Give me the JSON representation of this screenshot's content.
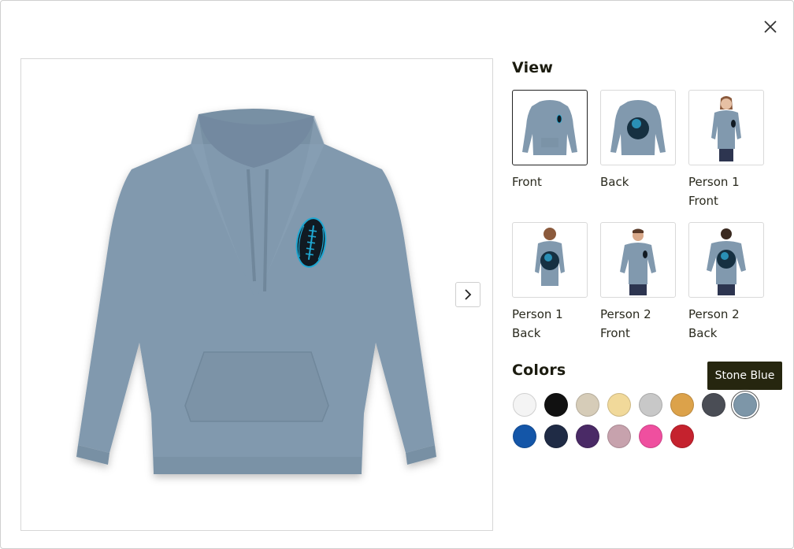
{
  "view": {
    "title": "View",
    "thumbnails": [
      {
        "label": "Front",
        "selected": true
      },
      {
        "label": "Back",
        "selected": false
      },
      {
        "label": "Person 1 Front",
        "selected": false
      },
      {
        "label": "Person 1 Back",
        "selected": false
      },
      {
        "label": "Person 2 Front",
        "selected": false
      },
      {
        "label": "Person 2 Back",
        "selected": false
      }
    ]
  },
  "colors": {
    "title": "Colors",
    "tooltip": "Stone Blue",
    "swatches": [
      {
        "color": "#f4f4f4",
        "selected": false
      },
      {
        "color": "#111111",
        "selected": false
      },
      {
        "color": "#d6ccb8",
        "selected": false
      },
      {
        "color": "#f1d99a",
        "selected": false
      },
      {
        "color": "#c8c8c8",
        "selected": false
      },
      {
        "color": "#dca24a",
        "selected": false
      },
      {
        "color": "#4a4d55",
        "selected": false
      },
      {
        "color": "#7d96a8",
        "selected": true
      },
      {
        "color": "#1456a8",
        "selected": false
      },
      {
        "color": "#1f2b45",
        "selected": false
      },
      {
        "color": "#4a2a66",
        "selected": false
      },
      {
        "color": "#c7a2ad",
        "selected": false
      },
      {
        "color": "#ef4f9f",
        "selected": false
      },
      {
        "color": "#c5222e",
        "selected": false
      }
    ]
  },
  "product": {
    "hoodie_color": "#8199ae",
    "graphic": "football"
  },
  "icons": {
    "close": "close-icon",
    "next": "chevron-right-icon"
  }
}
